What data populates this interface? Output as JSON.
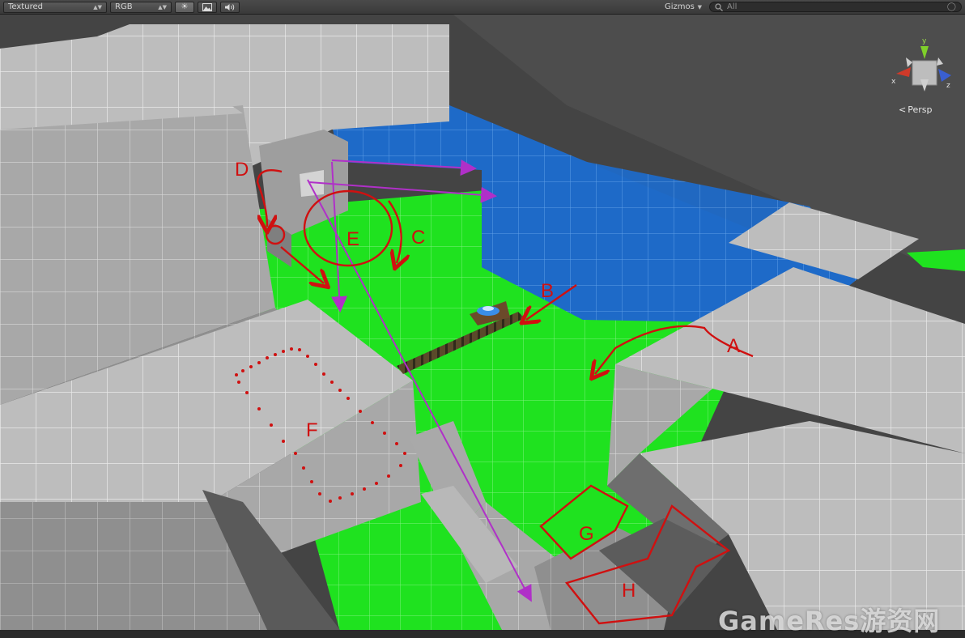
{
  "toolbar": {
    "render_mode": "Textured",
    "color_mode": "RGB",
    "sun_icon": "sun-icon",
    "image_icon": "image-icon",
    "audio_icon": "audio-icon",
    "gizmos_label": "Gizmos",
    "search_placeholder": "All",
    "search_icon": "search-icon"
  },
  "scene_gizmo": {
    "y_label": "y",
    "x_label": "x",
    "z_label": "z",
    "projection": "Persp",
    "colors": {
      "x": "#d03a2a",
      "y": "#7fd02a",
      "z": "#3a5fd0"
    }
  },
  "annotations": [
    "A",
    "B",
    "C",
    "D",
    "E",
    "F",
    "G",
    "H"
  ],
  "watermark": "GameRes游资网",
  "colors": {
    "walkable_green": "#1fe21f",
    "water_blue": "#1e6ac8",
    "stone_gray": "#bcbcbc",
    "annotation_red": "#d01010",
    "arrow_purple": "#b030c8"
  }
}
